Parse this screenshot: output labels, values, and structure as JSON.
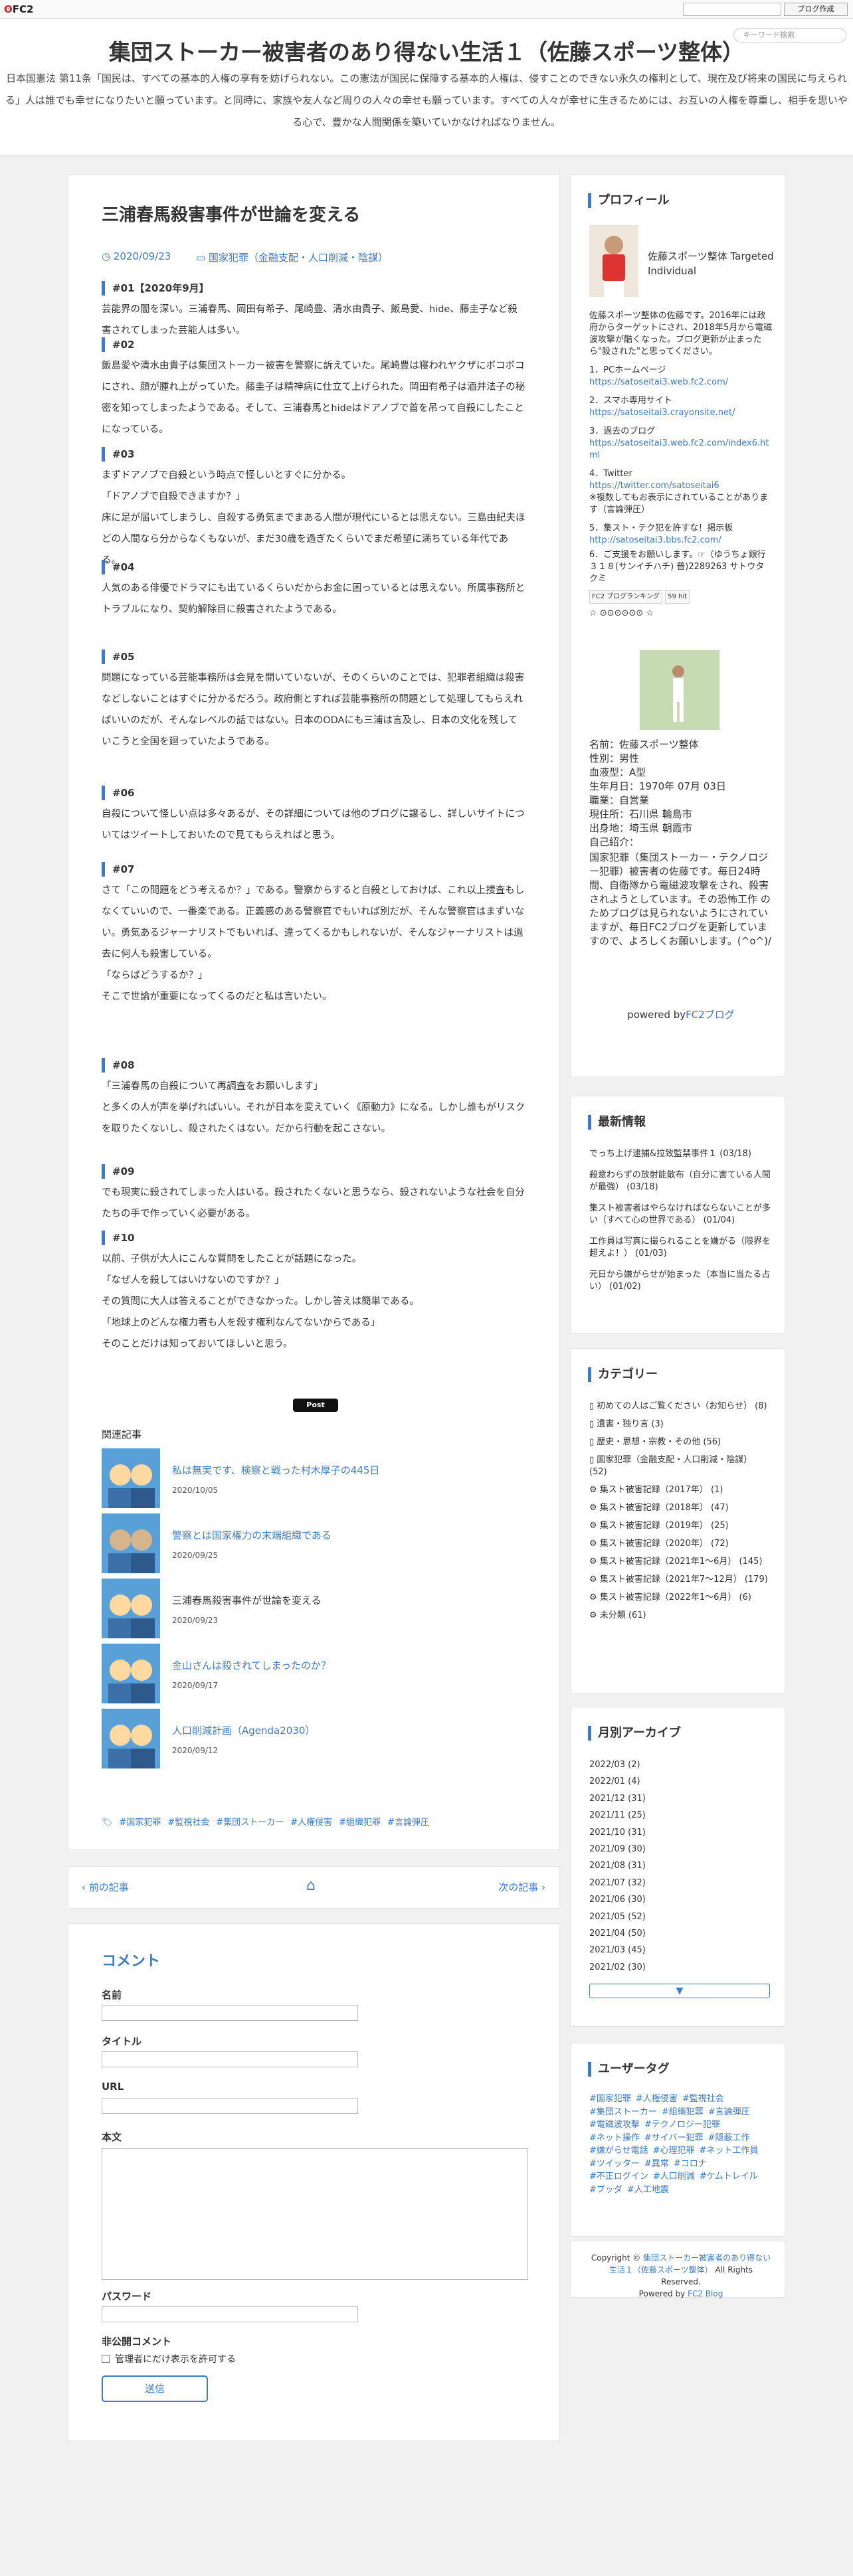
{
  "topbar": {
    "logo": "FC2",
    "search_placeholder": "",
    "make_blog": "ブログ作成"
  },
  "header": {
    "title": "集団ストーカー被害者のあり得ない生活１（佐藤スポーツ整体）",
    "desc": "日本国憲法 第11条「国民は、すべての基本的人権の享有を妨げられない。この憲法が国民に保障する基本的人権は、侵すことのできない永久の権利として、現在及び将来の国民に与えられる」人は誰でも幸せになりたいと願っています。と同時に、家族や友人など周りの人々の幸せも願っています。すべての人々が幸せに生きるためには、お互いの人権を尊重し、相手を思いやる心で、豊かな人間関係を築いていかなければなりません。",
    "search_placeholder": "キーワード検索"
  },
  "entry": {
    "title": "三浦春馬殺害事件が世論を変える",
    "date": "2020/09/23",
    "category": "国家犯罪（金融支配・人口削減・陰謀）",
    "sections": [
      {
        "h": "#01【2020年9月】",
        "t": [
          "芸能界の闇を深い。三浦春馬、岡田有希子、尾崎豊、清水由貴子、飯島愛、hide、藤圭子など殺害されてしまった芸能人は多い。"
        ]
      },
      {
        "h": "#02",
        "t": [
          "飯島愛や清水由貴子は集団ストーカー被害を警察に訴えていた。尾崎豊は寝われヤクザにボコボコにされ、顔が腫れ上がっていた。藤圭子は精神病に仕立て上げられた。岡田有希子は酒井法子の秘密を知ってしまったようである。そして、三浦春馬とhideはドアノブで首を吊って自殺にしたことになっている。"
        ]
      },
      {
        "h": "#03",
        "t": [
          "まずドアノブで自殺という時点で怪しいとすぐに分かる。",
          "「ドアノブで自殺できますか？」",
          "床に足が届いてしまうし、自殺する勇気までまある人間が現代にいるとは思えない。三島由紀夫ほどの人間なら分からなくもないが、まだ30歳を過ぎたくらいでまだ希望に満ちている年代である。"
        ]
      },
      {
        "h": "#04",
        "t": [
          "人気のある俳優でドラマにも出ているくらいだからお金に困っているとは思えない。所属事務所とトラブルになり、契約解除目に殺害されたようである。"
        ]
      },
      {
        "h": "#05",
        "t": [
          "問題になっている芸能事務所は会見を開いていないが、そのくらいのことでは、犯罪者組織は殺害などしないことはすぐに分かるだろう。政府側とすれば芸能事務所の問題として処理してもらえればいいのだが、そんなレベルの話ではない。日本のODAにも三浦は言及し、日本の文化を残していこうと全国を廻っていたようである。"
        ]
      },
      {
        "h": "#06",
        "t": [
          "自殺について怪しい点は多々あるが、その詳細については他のブログに譲るし、詳しいサイトについてはツイートしておいたので見てもらえればと思う。"
        ]
      },
      {
        "h": "#07",
        "t": [
          "さて「この問題をどう考えるか？」である。警察からすると自殺としておけば、これ以上捜査もしなくていいので、一番楽である。正義感のある警察官でもいれば別だが、そんな警察官はまずいない。勇気あるジャーナリストでもいれば、違ってくるかもしれないが、そんなジャーナリストは過去に何人も殺害している。",
          "「ならばどうするか？」",
          "そこで世論が重要になってくるのだと私は言いたい。"
        ]
      },
      {
        "h": "#08",
        "t": [
          "「三浦春馬の自殺について再調査をお願いします」",
          "と多くの人が声を挙げればいい。それが日本を変えていく《原動力》になる。しかし誰もがリスクを取りたくないし、殺されたくはない。だから行動を起こさない。"
        ]
      },
      {
        "h": "#09",
        "t": [
          "でも現実に殺されてしまった人はいる。殺されたくないと思うなら、殺されないような社会を自分たちの手で作っていく必要がある。"
        ]
      },
      {
        "h": "#10",
        "t": [
          "以前、子供が大人にこんな質問をしたことが話題になった。",
          "「なぜ人を殺してはいけないのですか？」",
          "その質問に大人は答えることができなかった。しかし答えは簡単である。",
          "「地球上のどんな権力者も人を殺す権利なんてないからである」",
          "そのことだけは知っておいてほしいと思う。"
        ]
      }
    ],
    "tweet": "Post",
    "related_heading": "関連記事",
    "related": [
      {
        "title": "私は無実です、検察と戦った村木厚子の445日",
        "date": "2020/10/05",
        "link": true
      },
      {
        "title": "警察とは国家権力の末端組織である",
        "date": "2020/09/25",
        "link": true
      },
      {
        "title": "三浦春馬殺害事件が世論を変える",
        "date": "2020/09/23",
        "link": false
      },
      {
        "title": "金山さんは殺されてしまったのか？",
        "date": "2020/09/17",
        "link": true
      },
      {
        "title": "人口削減計画（Agenda2030）",
        "date": "2020/09/12",
        "link": true
      }
    ],
    "tags": [
      "#国家犯罪",
      "#監視社会",
      "#集団ストーカー",
      "#人権侵害",
      "#組織犯罪",
      "#言論弾圧"
    ]
  },
  "pager": {
    "prev": "前の記事",
    "next": "次の記事"
  },
  "comment": {
    "title": "コメント",
    "name": "名前",
    "title_label": "タイトル",
    "url": "URL",
    "body": "本文",
    "password": "パスワード",
    "private": "非公開コメント",
    "private_check": "管理者にだけ表示を許可する",
    "submit": "送信"
  },
  "profile": {
    "title": "プロフィール",
    "name": "佐藤スポーツ整体 Targeted Individual",
    "intro": "佐藤スポーツ整体の佐藤です。2016年には政府からターゲットにされ、2018年5月から電磁波攻撃が酷くなった。ブログ更新が止まったら\"殺された\"と思ってください。",
    "links": [
      {
        "label": "1．PCホームページ",
        "url": "https://satoseitai3.web.fc2.com/"
      },
      {
        "label": "2．スマホ専用サイト",
        "url": "https://satoseitai3.crayonsite.net/"
      },
      {
        "label": "3．過去のブログ",
        "url": "https://satoseitai3.web.fc2.com/index6.html"
      },
      {
        "label": "4．Twitter",
        "url": "https://twitter.com/satoseitai6",
        "note": "※複数してもお表示にされていることがあります（言論弾圧）"
      },
      {
        "label": "5．集スト・テク犯を許すな！掲示板",
        "url": "http://satoseitai3.bbs.fc2.com/"
      }
    ],
    "support": "6．ご支援をお願いします。☞（ゆうちょ銀行 ３１８(サンイチハチ) 普)2289263 サトウタクミ",
    "rank_badge": "FC2 ブログランキング",
    "count": "59 hit",
    "details": [
      "名前：佐藤スポーツ整体",
      "性別：男性",
      "血液型：A型",
      "生年月日：1970年 07月 03日",
      "職業：自営業",
      "現住所：石川県 輪島市",
      "出身地：埼玉県 朝霞市",
      "自己紹介："
    ],
    "bio": "国家犯罪（集団ストーカー・テクノロジー犯罪）被害者の佐藤です。毎日24時間、自衛隊から電磁波攻撃をされ、殺害されようとしています。その恐怖工作 のためブログは見られないようにされていますが、毎日FC2ブログを更新していますので、よろしくお願いします。(^o^)/",
    "powered_prefix": "powered by",
    "powered_link": "FC2ブログ"
  },
  "recent": {
    "title": "最新情報",
    "items": [
      {
        "t": "でっち上げ逮捕&拉致監禁事件１",
        "d": "(03/18)"
      },
      {
        "t": "殺意わらずの放射能散布（自分に害ている人間が最強）",
        "d": "(03/18)"
      },
      {
        "t": "集スト被害者はやらなければならないことが多い（すべて心の世界である）",
        "d": "(01/04)"
      },
      {
        "t": "工作員は写真に撮られることを嫌がる（限界を超えよ！）",
        "d": "(01/03)"
      },
      {
        "t": "元日から嫌がらせが始まった（本当に当たる占い）",
        "d": "(01/02)"
      }
    ]
  },
  "categories": {
    "title": "カテゴリー",
    "items": [
      "初めての人はご覧ください（お知らせ） (8)",
      "遺書・独り言 (3)",
      "歴史・思想・宗教・その他 (56)",
      "国家犯罪（金融支配・人口削減・陰謀） (52)",
      "集スト被害記録（2017年） (1)",
      "集スト被害記録（2018年） (47)",
      "集スト被害記録（2019年） (25)",
      "集スト被害記録（2020年） (72)",
      "集スト被害記録（2021年1〜6月） (145)",
      "集スト被害記録（2021年7〜12月） (179)",
      "集スト被害記録（2022年1〜6月） (6)",
      "未分類 (61)"
    ]
  },
  "archive": {
    "title": "月別アーカイブ",
    "items": [
      "2022/03 (2)",
      "2022/01 (4)",
      "2021/12 (31)",
      "2021/11 (25)",
      "2021/10 (31)",
      "2021/09 (30)",
      "2021/08 (31)",
      "2021/07 (32)",
      "2021/06 (30)",
      "2021/05 (52)",
      "2021/04 (50)",
      "2021/03 (45)",
      "2021/02 (30)"
    ]
  },
  "usertags": {
    "title": "ユーザータグ",
    "items": [
      "#国家犯罪",
      "#人権侵害",
      "#監視社会",
      "#集団ストーカー",
      "#組織犯罪",
      "#言論弾圧",
      "#電磁波攻撃",
      "#テクノロジー犯罪",
      "#ネット操作",
      "#サイバー犯罪",
      "#隠蔽工作",
      "#嫌がらせ電話",
      "#心理犯罪",
      "#ネット工作員",
      "#ツイッター",
      "#異常",
      "#コロナ",
      "#不正ログイン",
      "#人口削減",
      "#ケムトレイル",
      "#ブッダ",
      "#人工地震"
    ]
  },
  "copyright": {
    "prefix": "Copyright ©",
    "site": "集団ストーカー被害者のあり得ない生活１（佐藤スポーツ整体）",
    "suffix": "All Rights Reserved.",
    "powered": "Powered by",
    "fc2": "FC2 Blog"
  }
}
